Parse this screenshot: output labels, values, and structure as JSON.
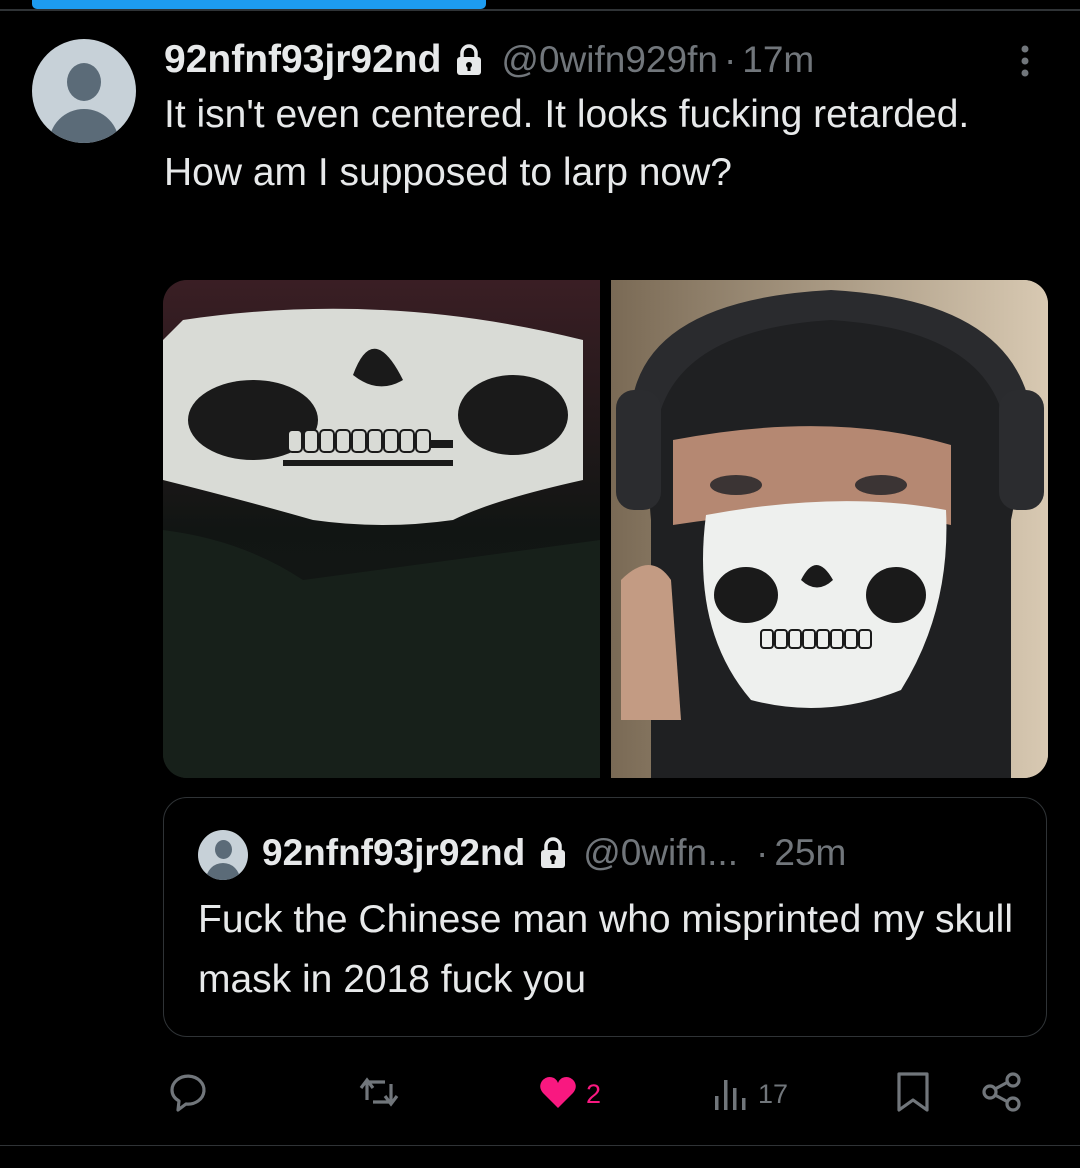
{
  "progress": {
    "fraction": 0.42
  },
  "tweet": {
    "display_name": "92nfnf93jr92nd",
    "handle": "@0wifn929fn",
    "separator": "·",
    "time": "17m",
    "text": "It isn't even centered. It looks fucking retarded. How am I supposed to larp now?",
    "lock_icon": "lock-icon",
    "more_icon": "more-vertical-icon"
  },
  "media": {
    "items": [
      {
        "icon": "skull-mask-photo"
      },
      {
        "icon": "balaclava-selfie-photo"
      }
    ]
  },
  "quote": {
    "display_name": "92nfnf93jr92nd",
    "handle": "@0wifn...",
    "separator": "·",
    "time": "25m",
    "text": "Fuck the Chinese man who misprinted my skull mask in 2018 fuck you"
  },
  "actions": {
    "reply_count": "",
    "retweet_count": "",
    "like_count": "2",
    "views_count": "17"
  },
  "colors": {
    "background": "#000000",
    "text": "#e7e9ea",
    "muted": "#71767b",
    "accent": "#1d9bf0",
    "like": "#f91880",
    "border": "#2f3336"
  }
}
